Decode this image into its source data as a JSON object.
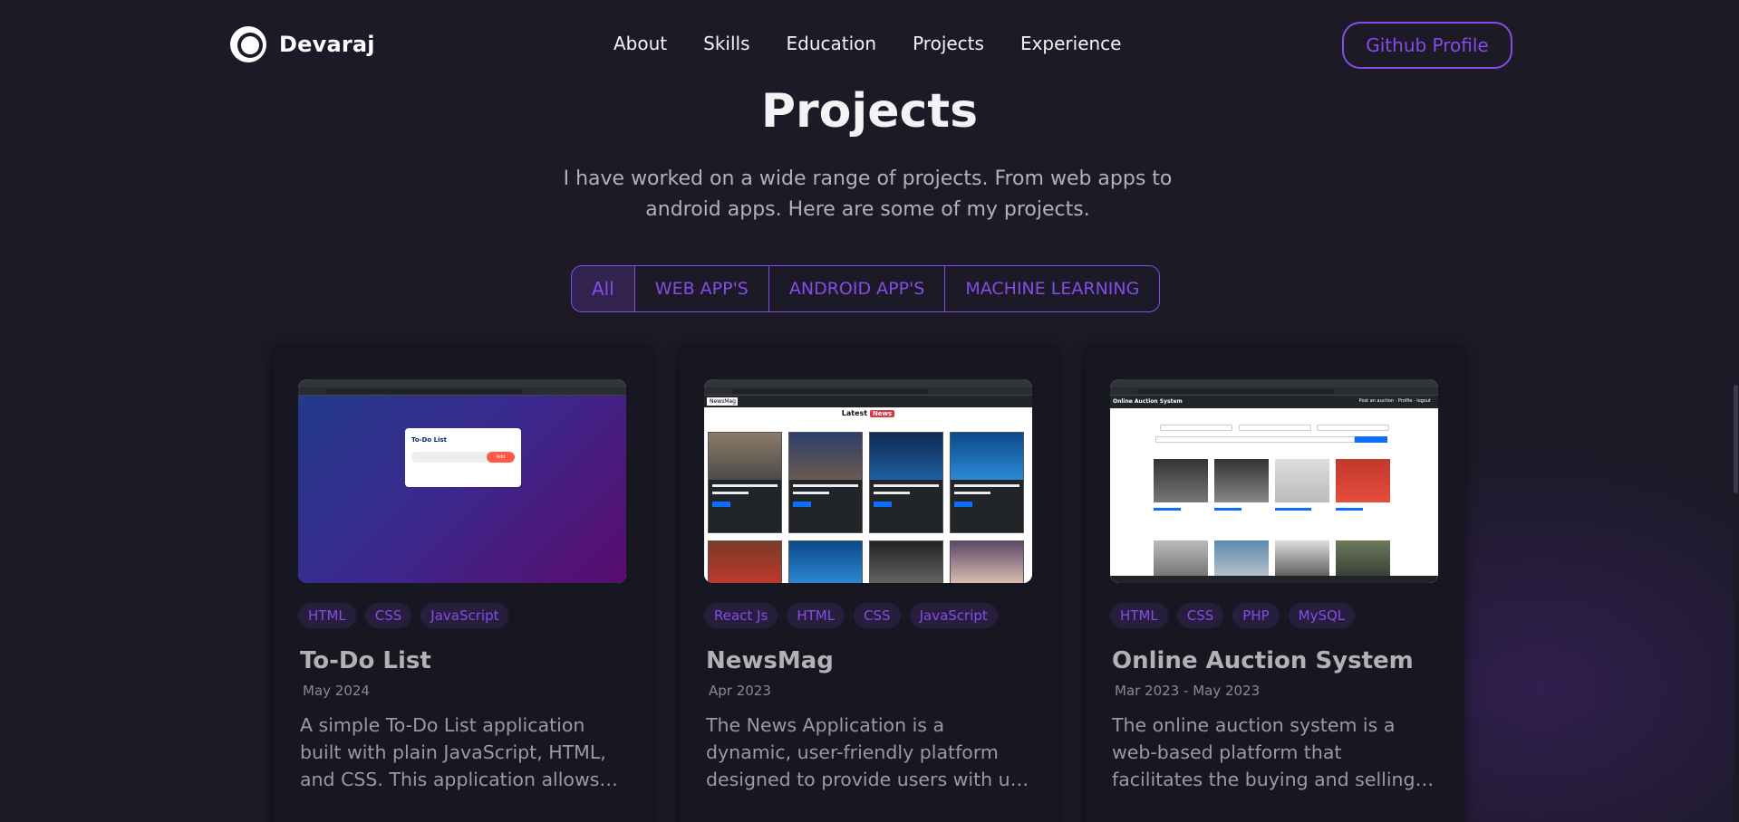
{
  "navbar": {
    "logo_text": "Devaraj",
    "links": [
      "About",
      "Skills",
      "Education",
      "Projects",
      "Experience"
    ],
    "github_button": "Github Profile"
  },
  "projects_section": {
    "title": "Projects",
    "description": "I have worked on a wide range of projects. From web apps to android apps. Here are some of my projects.",
    "filters": [
      "All",
      "WEB APP'S",
      "ANDROID APP'S",
      "MACHINE LEARNING"
    ],
    "active_filter": "All"
  },
  "projects": [
    {
      "title": "To-Do List",
      "date": "May 2024",
      "tags": [
        "HTML",
        "CSS",
        "JavaScript"
      ],
      "description": "A simple To-Do List application built with plain JavaScript, HTML, and CSS. This application allows you to..."
    },
    {
      "title": "NewsMag",
      "date": "Apr 2023",
      "tags": [
        "React Js",
        "HTML",
        "CSS",
        "JavaScript"
      ],
      "description": "The News Application is a dynamic, user-friendly platform designed to provide users with up-to-date..."
    },
    {
      "title": "Online Auction System",
      "date": "Mar 2023 - May 2023",
      "tags": [
        "HTML",
        "CSS",
        "PHP",
        "MySQL"
      ],
      "description": "The online auction system is a web-based platform that facilitates the buying and selling o..."
    }
  ],
  "screenshots": {
    "todo": {
      "box_title": "To-Do List",
      "add_label": "Add"
    },
    "newsmag": {
      "brand": "NewsMag",
      "latest": "Latest",
      "badge": "News"
    },
    "auction": {
      "brand": "Online Auction System",
      "nav_right": "Post an auction · Profile · logout"
    }
  },
  "colors": {
    "background": "#1c1a27",
    "card": "#171721",
    "accent": "#854ce6",
    "text_primary": "#f2f3f4",
    "text_secondary": "#b1b2b3"
  }
}
